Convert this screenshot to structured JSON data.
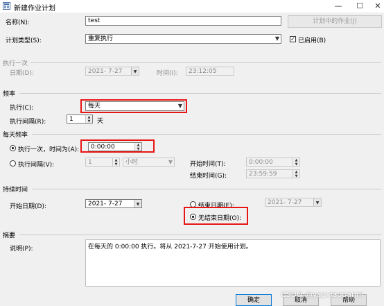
{
  "window": {
    "title": "新建作业计划",
    "minimize_glyph": "—",
    "maximize_glyph": "☐",
    "close_glyph": "✕"
  },
  "name": {
    "label": "名称(N):",
    "value": "test",
    "jobs_in_schedule_button": "计划中的作业(J)"
  },
  "schedule_type": {
    "label": "计划类型(S):",
    "value": "重复执行",
    "enabled_label": "已启用(B)",
    "enabled_checked": true
  },
  "one_time": {
    "section_title": "执行一次",
    "date_label": "日期(D):",
    "date_value": "2021- 7-27",
    "time_label": "时间(I):",
    "time_value": "23:12:05"
  },
  "frequency": {
    "section_title": "频率",
    "occurs_label": "执行(C):",
    "occurs_value": "每天",
    "recurs_label": "执行间隔(R):",
    "recurs_value": "1",
    "recurs_unit": "天"
  },
  "daily_frequency": {
    "section_title": "每天频率",
    "once_label": "执行一次，时间为(A):",
    "once_time": "0:00:00",
    "every_label": "执行间隔(V):",
    "every_value": "1",
    "every_unit": "小时",
    "start_time_label": "开始时间(T):",
    "start_time_value": "0:00:00",
    "end_time_label": "结束时间(G):",
    "end_time_value": "23:59:59",
    "selected": "once"
  },
  "duration": {
    "section_title": "持续时间",
    "start_date_label": "开始日期(D):",
    "start_date_value": "2021- 7-27",
    "end_date_label": "结束日期(E):",
    "end_date_value": "2021- 7-27",
    "no_end_label": "无结束日期(O):",
    "selected": "no_end"
  },
  "summary": {
    "section_title": "摘要",
    "description_label": "说明(P):",
    "description_text": "在每天的 0:00:00 执行。将从 2021-7-27 开始使用计划。"
  },
  "buttons": {
    "ok": "确定",
    "cancel": "取消",
    "help": "帮助"
  },
  "watermark": "CSDN @yspxiaopanni",
  "colors": {
    "highlight_red": "#e81515",
    "dialog_bg": "#f0f0f0"
  }
}
